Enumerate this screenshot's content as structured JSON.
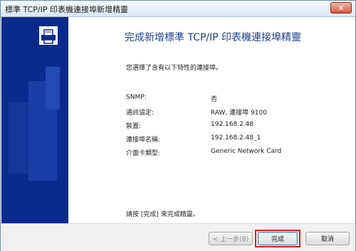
{
  "window": {
    "title": "標準 TCP/IP 印表機連接埠新增精靈",
    "close_glyph": "✕"
  },
  "wizard": {
    "heading": "完成新增標準 TCP/IP 印表機連接埠精靈",
    "intro": "您選擇了含有以下特性的連接埠。",
    "properties": [
      {
        "label": "SNMP:",
        "value": "否"
      },
      {
        "label": "通訊協定:",
        "value": "RAW, 連接埠 9100"
      },
      {
        "label": "裝置:",
        "value": "192.168.2.48"
      },
      {
        "label": "連接埠名稱:",
        "value": "192.168.2.48_1"
      },
      {
        "label": "介面卡類型:",
        "value": "Generic Network Card"
      }
    ],
    "footer_note": "請按 [完成] 來完成精靈。"
  },
  "buttons": {
    "back": "< 上一步(B)",
    "finish": "完成",
    "cancel": "取消"
  },
  "colors": {
    "sidebar": "#0a2b8c",
    "heading": "#1f3f8c",
    "highlight": "#e01e24"
  },
  "icons": {
    "wizard": "printer-icon",
    "close": "close-icon"
  }
}
